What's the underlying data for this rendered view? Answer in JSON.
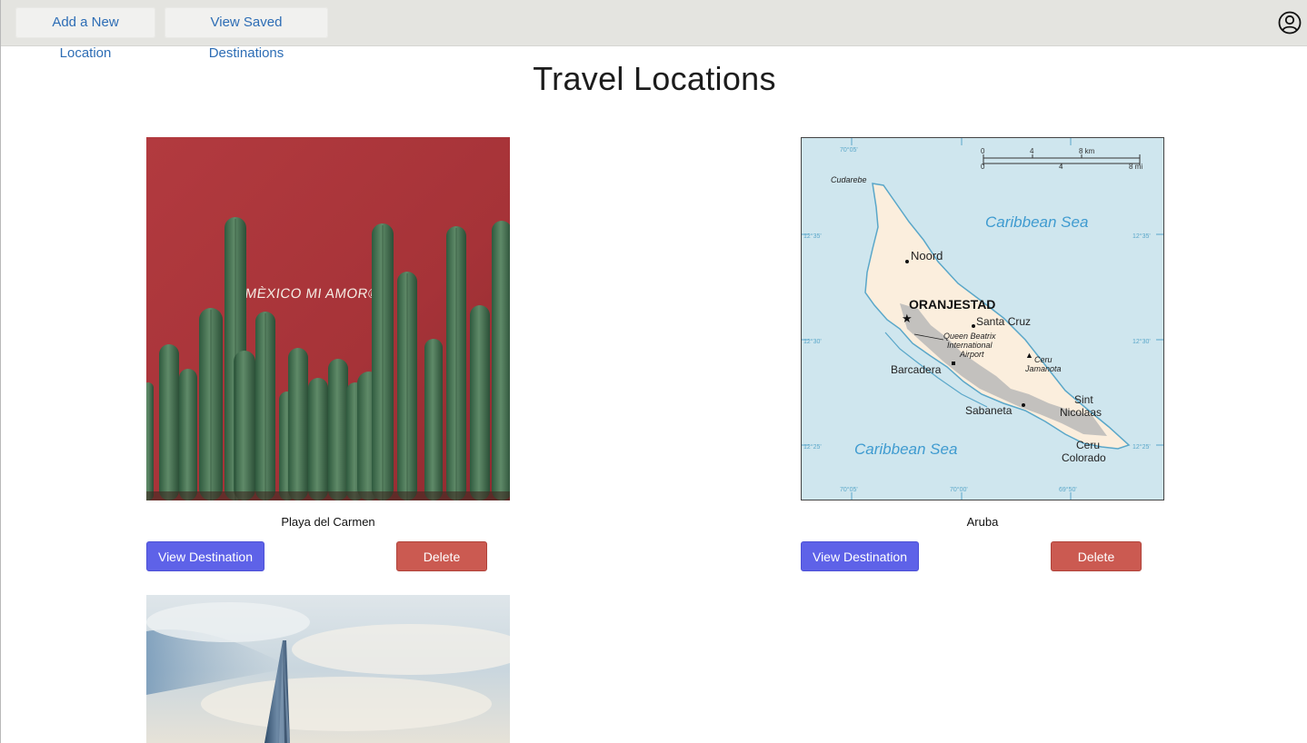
{
  "nav": {
    "add_location": "Add a New Location",
    "saved_destinations": "View Saved Destinations",
    "profile_icon": "user-circle-icon"
  },
  "page": {
    "title": "Travel Locations"
  },
  "locations": [
    {
      "name": "Playa del Carmen",
      "image_text": "MÈXICO MI AMOR®",
      "view_label": "View Destination",
      "delete_label": "Delete"
    },
    {
      "name": "Aruba",
      "view_label": "View Destination",
      "delete_label": "Delete",
      "map_labels": {
        "scale_km": "8 km",
        "scale_mi": "8 mi",
        "scale_0": "0",
        "scale_4": "4",
        "scale_8": "8",
        "cudarebe": "Cudarebe",
        "sea_north": "Caribbean Sea",
        "sea_south": "Caribbean Sea",
        "noord": "Noord",
        "capital": "ORANJESTAD",
        "santa_cruz": "Santa Cruz",
        "airport_1": "Queen Beatrix",
        "airport_2": "International",
        "airport_3": "Airport",
        "ceru_jam_1": "Ceru",
        "ceru_jam_2": "Jamanota",
        "barcadera": "Barcadera",
        "sint_1": "Sint",
        "sint_2": "Nicolaas",
        "sabaneta": "Sabaneta",
        "ceru_col_1": "Ceru",
        "ceru_col_2": "Colorado",
        "lat_1235": "12°35'",
        "lat_1230": "12°30'",
        "lat_1225": "12°25'",
        "lon_7005": "70°05'",
        "lon_7000": "70°00'",
        "lon_6950": "69°50'"
      }
    },
    {
      "name": ""
    }
  ],
  "colors": {
    "topbar": "#e4e4e0",
    "nav_link": "#2d6db5",
    "view_button": "#5e62e8",
    "delete_button": "#cb5a51",
    "cactus_wall": "#a8363a",
    "sea": "#cfe6ee",
    "land": "#fbeedd"
  }
}
